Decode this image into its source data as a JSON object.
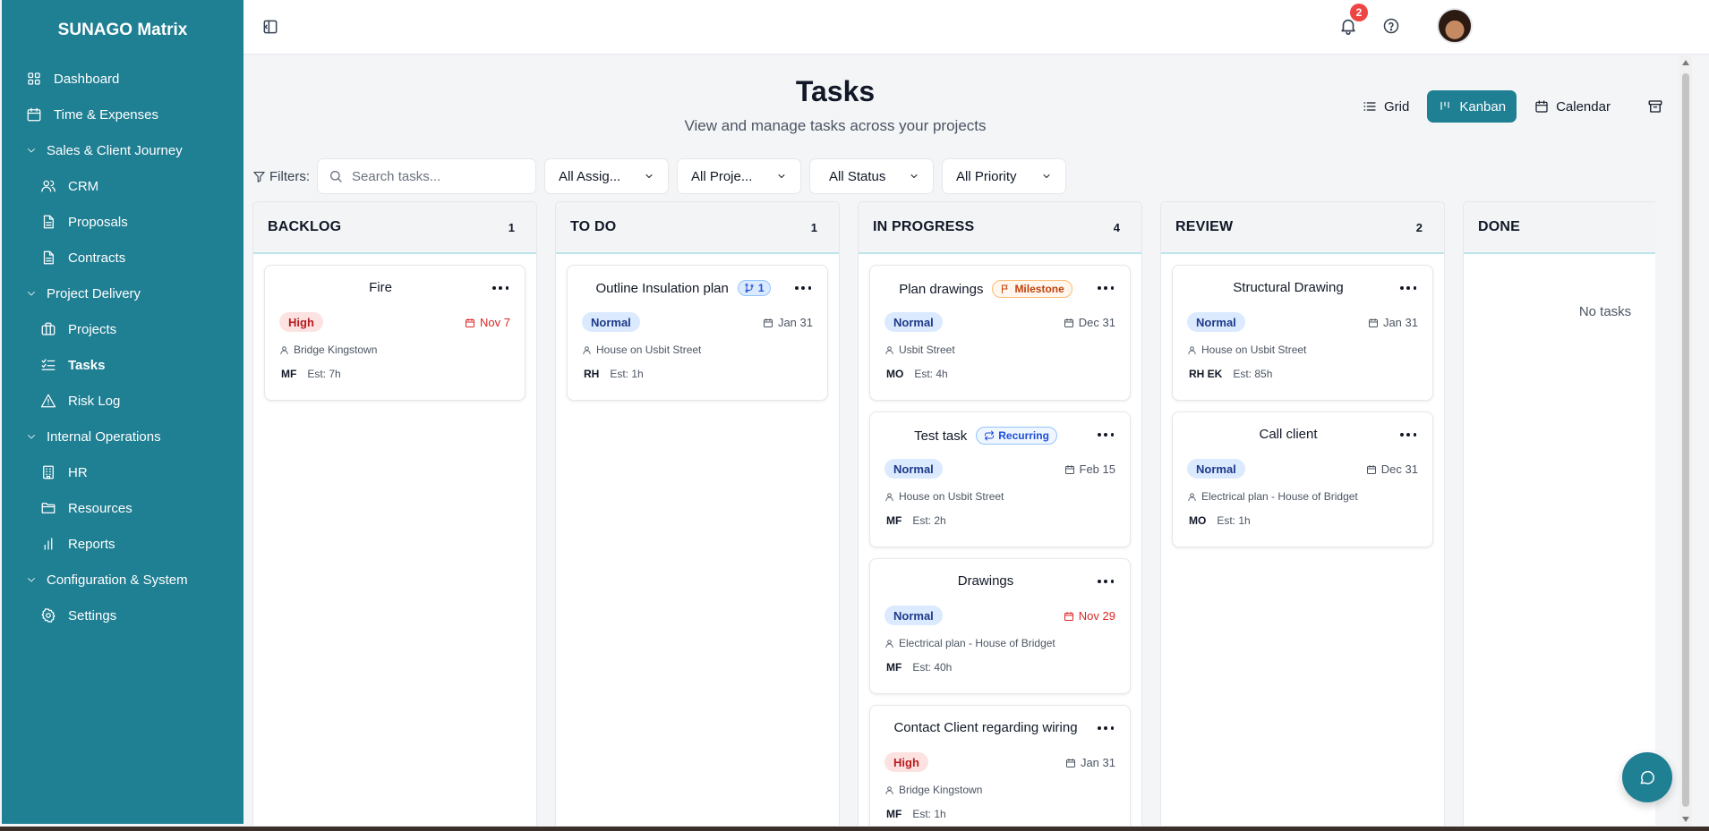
{
  "app": {
    "brand": "SUNAGO Matrix"
  },
  "sidebar": {
    "items": [
      {
        "label": "Dashboard",
        "icon": "grid-icon",
        "kind": "item",
        "level": 0
      },
      {
        "label": "Time & Expenses",
        "icon": "calendar-icon",
        "kind": "item",
        "level": 0
      },
      {
        "label": "Sales & Client Journey",
        "icon": "chevron-down-icon",
        "kind": "section"
      },
      {
        "label": "CRM",
        "icon": "users-icon",
        "kind": "item",
        "level": 1
      },
      {
        "label": "Proposals",
        "icon": "file-icon",
        "kind": "item",
        "level": 1
      },
      {
        "label": "Contracts",
        "icon": "file-icon",
        "kind": "item",
        "level": 1
      },
      {
        "label": "Project Delivery",
        "icon": "chevron-down-icon",
        "kind": "section"
      },
      {
        "label": "Projects",
        "icon": "briefcase-icon",
        "kind": "item",
        "level": 1
      },
      {
        "label": "Tasks",
        "icon": "list-check-icon",
        "kind": "item",
        "level": 1,
        "active": true
      },
      {
        "label": "Risk Log",
        "icon": "warning-icon",
        "kind": "item",
        "level": 1
      },
      {
        "label": "Internal Operations",
        "icon": "chevron-down-icon",
        "kind": "section"
      },
      {
        "label": "HR",
        "icon": "building-icon",
        "kind": "item",
        "level": 1
      },
      {
        "label": "Resources",
        "icon": "folder-icon",
        "kind": "item",
        "level": 1
      },
      {
        "label": "Reports",
        "icon": "bar-chart-icon",
        "kind": "item",
        "level": 1
      },
      {
        "label": "Configuration & System",
        "icon": "chevron-down-icon",
        "kind": "section"
      },
      {
        "label": "Settings",
        "icon": "gear-icon",
        "kind": "item",
        "level": 1
      }
    ]
  },
  "topbar": {
    "notifications_count": "2"
  },
  "header": {
    "title": "Tasks",
    "subtitle": "View and manage tasks across your projects"
  },
  "views": {
    "grid": "Grid",
    "kanban": "Kanban",
    "calendar": "Calendar",
    "active": "kanban"
  },
  "filters": {
    "label": "Filters:",
    "search_placeholder": "Search tasks...",
    "search_value": "",
    "assignee": "All Assig...",
    "project": "All Proje...",
    "status": "All Status",
    "priority": "All Priority"
  },
  "columns": [
    {
      "title": "BACKLOG",
      "count": "1",
      "empty_text": "",
      "cards": [
        {
          "title": "Fire",
          "tag": null,
          "priority": "High",
          "due": "Nov 7",
          "overdue": true,
          "project": "Bridge Kingstown",
          "assignees": "MF",
          "estimate": "Est: 7h"
        }
      ]
    },
    {
      "title": "TO DO",
      "count": "1",
      "empty_text": "",
      "cards": [
        {
          "title": "Outline Insulation plan",
          "tag": {
            "type": "sub",
            "label": "1"
          },
          "priority": "Normal",
          "due": "Jan 31",
          "overdue": false,
          "project": "House on Usbit Street",
          "assignees": "RH",
          "estimate": "Est: 1h"
        }
      ]
    },
    {
      "title": "IN PROGRESS",
      "count": "4",
      "empty_text": "",
      "cards": [
        {
          "title": "Plan drawings",
          "tag": {
            "type": "milestone",
            "label": "Milestone"
          },
          "priority": "Normal",
          "due": "Dec 31",
          "overdue": false,
          "project": "Usbit Street",
          "assignees": "MO",
          "estimate": "Est: 4h"
        },
        {
          "title": "Test task",
          "tag": {
            "type": "recurring",
            "label": "Recurring"
          },
          "priority": "Normal",
          "due": "Feb 15",
          "overdue": false,
          "project": "House on Usbit Street",
          "assignees": "MF",
          "estimate": "Est: 2h"
        },
        {
          "title": "Drawings",
          "tag": null,
          "priority": "Normal",
          "due": "Nov 29",
          "overdue": true,
          "project": "Electrical plan - House of Bridget",
          "assignees": "MF",
          "estimate": "Est: 40h"
        },
        {
          "title": "Contact Client regarding wiring",
          "tag": null,
          "priority": "High",
          "due": "Jan 31",
          "overdue": false,
          "project": "Bridge Kingstown",
          "assignees": "MF",
          "estimate": "Est: 1h"
        }
      ]
    },
    {
      "title": "REVIEW",
      "count": "2",
      "empty_text": "",
      "cards": [
        {
          "title": "Structural Drawing",
          "tag": null,
          "priority": "Normal",
          "due": "Jan 31",
          "overdue": false,
          "project": "House on Usbit Street",
          "assignees": "RH EK",
          "estimate": "Est: 85h"
        },
        {
          "title": "Call client",
          "tag": null,
          "priority": "Normal",
          "due": "Dec 31",
          "overdue": false,
          "project": "Electrical plan - House of Bridget",
          "assignees": "MO",
          "estimate": "Est: 1h"
        }
      ]
    },
    {
      "title": "DONE",
      "count": "",
      "empty_text": "No tasks",
      "cards": []
    }
  ],
  "colors": {
    "brand": "#1f7f93",
    "danger": "#ef4444",
    "normal_badge": "#dbeafe",
    "high_badge": "#fde2e2"
  }
}
